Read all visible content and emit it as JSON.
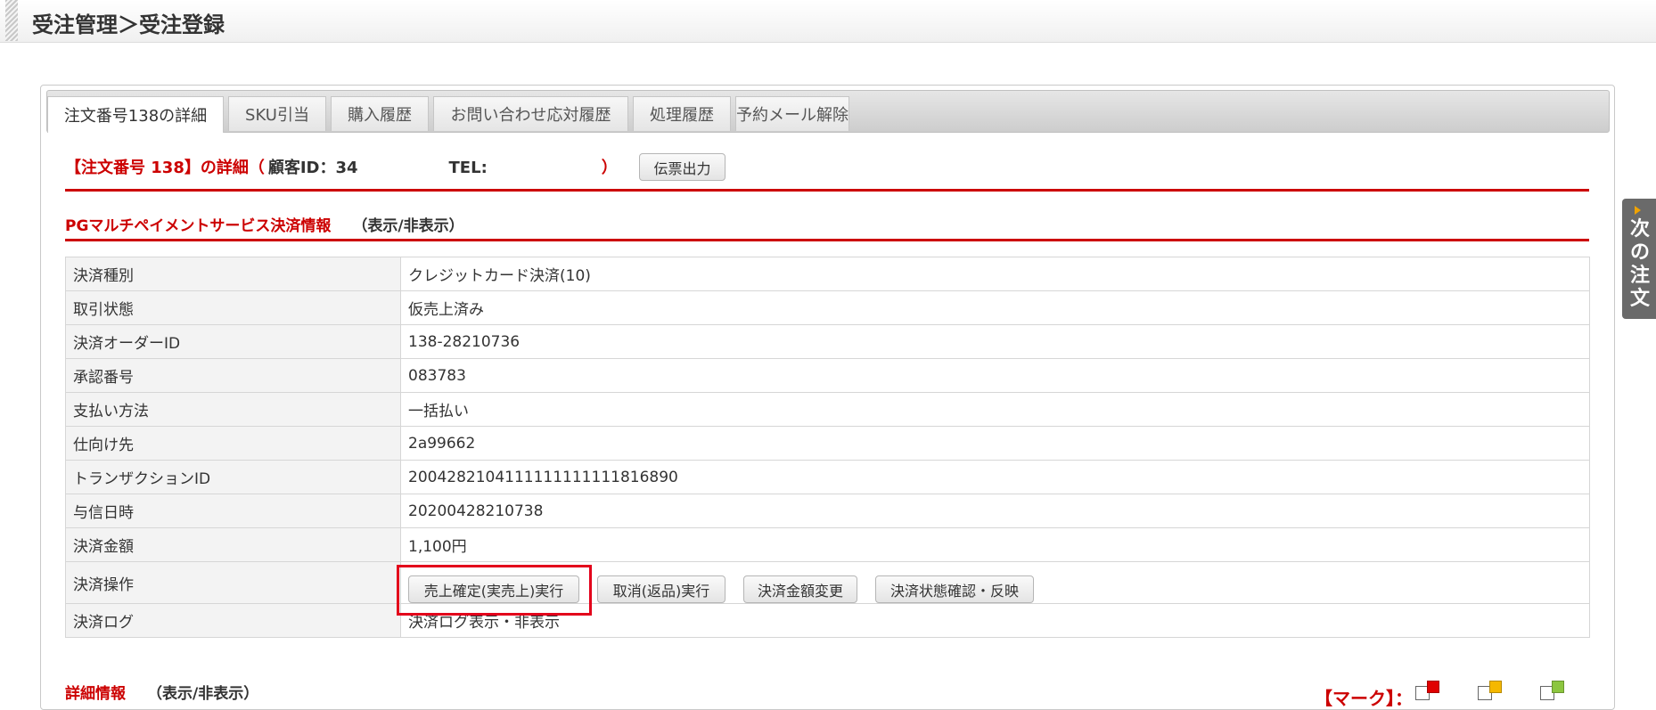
{
  "header": {
    "title": "受注管理＞受注登録"
  },
  "tabs": [
    {
      "label": "注文番号138の詳細",
      "active": true
    },
    {
      "label": "SKU引当"
    },
    {
      "label": "購入履歴"
    },
    {
      "label": "お問い合わせ応対履歴"
    },
    {
      "label": "処理履歴"
    },
    {
      "label": "予約メール解除"
    }
  ],
  "order": {
    "heading": "【注文番号 138】の詳細（",
    "customer_id": "顧客ID：34",
    "tel": "TEL:",
    "close_paren": "）",
    "slip_button": "伝票出力"
  },
  "payment_section": {
    "title": "PGマルチペイメントサービス決済情報",
    "toggle": "（表示/非表示）",
    "rows": [
      {
        "label": "決済種別",
        "value": "クレジットカード決済(10)"
      },
      {
        "label": "取引状態",
        "value": "仮売上済み"
      },
      {
        "label": "決済オーダーID",
        "value": "138-28210736"
      },
      {
        "label": "承認番号",
        "value": "083783"
      },
      {
        "label": "支払い方法",
        "value": "一括払い"
      },
      {
        "label": "仕向け先",
        "value": "2a99662"
      },
      {
        "label": "トランザクションID",
        "value": "2004282104111111111111816890"
      },
      {
        "label": "与信日時",
        "value": "20200428210738"
      },
      {
        "label": "決済金額",
        "value": "1,100円"
      }
    ],
    "operation": {
      "label": "決済操作",
      "buttons": [
        "売上確定(実売上)実行",
        "取消(返品)実行",
        "決済金額変更",
        "決済状態確認・反映"
      ]
    },
    "log": {
      "label": "決済ログ",
      "value": "決済ログ表示・非表示"
    }
  },
  "detail_section": {
    "title": "詳細情報",
    "toggle": "（表示/非表示）"
  },
  "marks": {
    "label": "【マーク】：",
    "colors": [
      "#e00000",
      "#f5b800",
      "#8cc63f"
    ]
  },
  "next_order": {
    "label": "次の注文"
  }
}
